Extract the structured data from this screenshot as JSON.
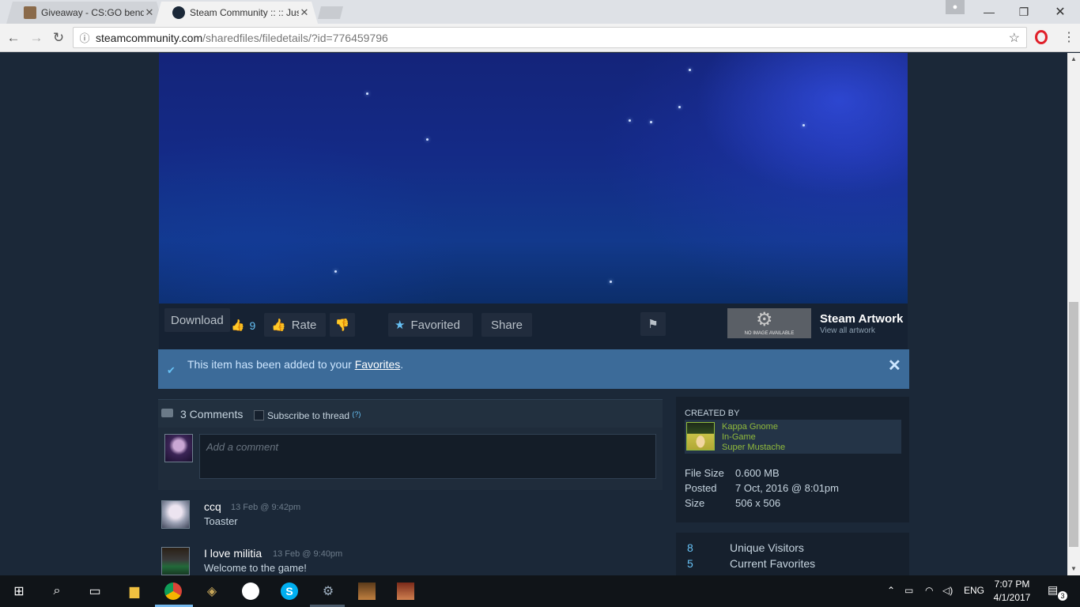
{
  "browser": {
    "tabs": [
      {
        "title": "Giveaway - CS:GO bend",
        "active": false
      },
      {
        "title": "Steam Community :: :: Jus",
        "active": true
      }
    ],
    "url_host": "steamcommunity.com",
    "url_path": "/sharedfiles/filedetails/?id=776459796"
  },
  "actions": {
    "download": "Download",
    "likes": "9",
    "rate": "Rate",
    "favorited": "Favorited",
    "share": "Share"
  },
  "app_info": {
    "logo_text": "NO IMAGE AVAILABLE",
    "title": "Steam Artwork",
    "subtitle": "View all artwork"
  },
  "notice": {
    "prefix": "This item has been added to your ",
    "link": "Favorites",
    "suffix": "."
  },
  "comments": {
    "count_label": "3 Comments",
    "subscribe_label": "Subscribe to thread",
    "help": "(?)",
    "placeholder": "Add a comment",
    "items": [
      {
        "author": "ccq",
        "time": "13 Feb @ 9:42pm",
        "text": "Toaster"
      },
      {
        "author": "I love militia",
        "time": "13 Feb @ 9:40pm",
        "text": "Welcome to the game!"
      }
    ]
  },
  "details": {
    "created_by_label": "CREATED BY",
    "creator_name": "Kappa Gnome",
    "creator_status": "In-Game",
    "creator_game": "Super Mustache",
    "stats": [
      {
        "label": "File Size",
        "value": "0.600 MB"
      },
      {
        "label": "Posted",
        "value": "7 Oct, 2016 @ 8:01pm"
      },
      {
        "label": "Size",
        "value": "506 x 506"
      }
    ]
  },
  "visitors": [
    {
      "value": "8",
      "label": "Unique Visitors"
    },
    {
      "value": "5",
      "label": "Current Favorites"
    }
  ],
  "taskbar": {
    "lang": "ENG",
    "time": "7:07 PM",
    "date": "4/1/2017",
    "notifications": "3"
  }
}
